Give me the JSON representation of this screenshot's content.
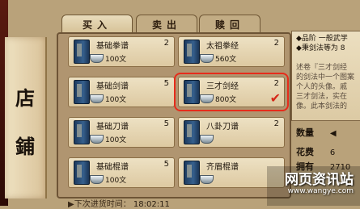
{
  "side_title": [
    "店",
    "鋪"
  ],
  "tabs": [
    {
      "label": "买入",
      "active": true
    },
    {
      "label": "卖出",
      "active": false
    },
    {
      "label": "赎回",
      "active": false
    }
  ],
  "items": [
    {
      "name": "基础拳谱",
      "qty": "2",
      "price": "100文",
      "selected": false
    },
    {
      "name": "太祖拳经",
      "qty": "2",
      "price": "560文",
      "selected": false
    },
    {
      "name": "基础剑谱",
      "qty": "5",
      "price": "100文",
      "selected": false
    },
    {
      "name": "三才剑经",
      "qty": "2",
      "price": "800文",
      "selected": true,
      "check": "✔"
    },
    {
      "name": "基础刀谱",
      "qty": "5",
      "price": "100文",
      "selected": false
    },
    {
      "name": "八卦刀谱",
      "qty": "2",
      "price": "",
      "selected": false
    },
    {
      "name": "基础棍谱",
      "qty": "5",
      "price": "100文",
      "selected": false
    },
    {
      "name": "齐眉棍谱",
      "qty": "",
      "price": "",
      "selected": false
    }
  ],
  "timer": {
    "label": "▶下次进货时间：",
    "value": "18:02:11"
  },
  "info": {
    "lines": [
      "◆品阶 一般武学",
      "◆秉剑法等为 8",
      "",
      "述卷『三才剑经",
      "的剑法中一个图案",
      "个人的头像。戚",
      "三才剑法，实在",
      "像。此本剑法的"
    ]
  },
  "stats": {
    "quantity": {
      "label": "数量",
      "value": ""
    },
    "cost": {
      "label": "花费",
      "value": "6"
    },
    "owned": {
      "label": "拥有",
      "value": "2710"
    }
  },
  "watermark": {
    "title": "网页资讯站",
    "url": "www.wangye.com"
  },
  "colors": {
    "highlight": "#e62c1b",
    "book": "#2b4c74"
  }
}
